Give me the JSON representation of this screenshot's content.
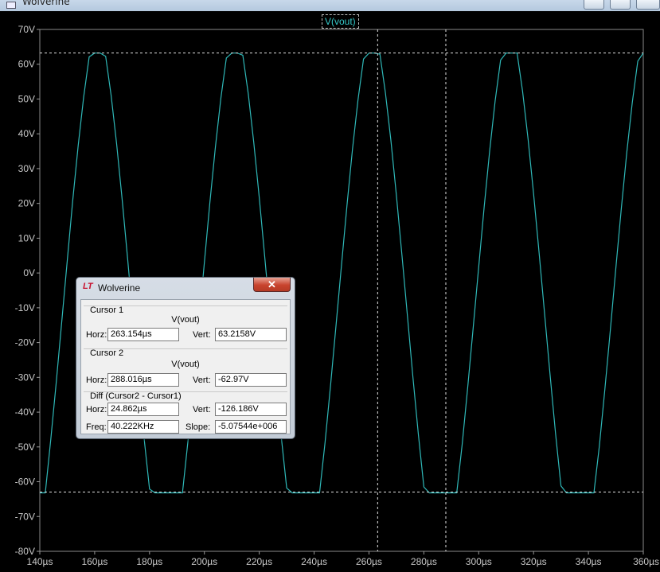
{
  "window": {
    "title": "Wolverine"
  },
  "trace_label": "V(vout)",
  "chart_data": {
    "type": "line",
    "title": "",
    "xlabel": "",
    "ylabel": "",
    "xlim": [
      140,
      360
    ],
    "ylim": [
      -80,
      70
    ],
    "x_unit": "µs",
    "y_unit": "V",
    "x_ticks": [
      140,
      160,
      180,
      200,
      220,
      240,
      260,
      280,
      300,
      320,
      340,
      360
    ],
    "y_ticks": [
      70,
      60,
      50,
      40,
      30,
      20,
      10,
      0,
      -10,
      -20,
      -30,
      -40,
      -50,
      -60,
      -70,
      -80
    ],
    "x_tick_labels": [
      "140µs",
      "160µs",
      "180µs",
      "200µs",
      "220µs",
      "240µs",
      "260µs",
      "280µs",
      "300µs",
      "320µs",
      "340µs",
      "360µs"
    ],
    "y_tick_labels": [
      "70V",
      "60V",
      "50V",
      "40V",
      "30V",
      "20V",
      "10V",
      "0V",
      "-10V",
      "-20V",
      "-30V",
      "-40V",
      "-50V",
      "-60V",
      "-70V",
      "-80V"
    ],
    "grid": false,
    "series": [
      {
        "name": "V(vout)",
        "color": "#2fb8b8",
        "x": [
          140.0,
          142.0,
          144.0,
          146.0,
          148.0,
          150.0,
          152.0,
          154.0,
          156.0,
          158.0,
          160.0,
          162.0,
          164.0,
          166.0,
          168.0,
          170.0,
          172.0,
          174.0,
          176.0,
          178.0,
          180.0,
          182.0,
          184.0,
          186.0,
          188.0,
          190.0,
          192.0,
          194.0,
          196.0,
          198.0,
          200.0,
          202.0,
          204.0,
          206.0,
          208.0,
          210.0,
          212.0,
          214.0,
          216.0,
          218.0,
          220.0,
          222.0,
          224.0,
          226.0,
          228.0,
          230.0,
          232.0,
          234.0,
          236.0,
          238.0,
          240.0,
          242.0,
          244.0,
          246.0,
          248.0,
          250.0,
          252.0,
          254.0,
          256.0,
          258.0,
          260.0,
          262.0,
          264.0,
          266.0,
          268.0,
          270.0,
          272.0,
          274.0,
          276.0,
          278.0,
          280.0,
          282.0,
          284.0,
          286.0,
          288.0,
          290.0,
          292.0,
          294.0,
          296.0,
          298.0,
          300.0,
          302.0,
          304.0,
          306.0,
          308.0,
          310.0,
          312.0,
          314.0,
          316.0,
          318.0,
          320.0,
          322.0,
          324.0,
          326.0,
          328.0,
          330.0,
          332.0,
          334.0,
          336.0,
          338.0,
          340.0,
          342.0,
          344.0,
          346.0,
          348.0,
          350.0,
          352.0,
          354.0,
          356.0,
          358.0,
          360.0
        ],
        "y": [
          -63.2,
          -63.2,
          -47.8,
          -31.3,
          -13.9,
          3.6,
          20.7,
          36.6,
          50.6,
          62.1,
          63.2,
          63.2,
          62.3,
          51.0,
          37.1,
          21.2,
          4.1,
          -13.4,
          -30.8,
          -47.3,
          -62.1,
          -63.2,
          -63.2,
          -63.2,
          -63.2,
          -63.2,
          -63.2,
          -48.3,
          -31.8,
          -14.5,
          3.0,
          20.2,
          36.1,
          50.2,
          61.8,
          63.2,
          63.2,
          62.6,
          51.4,
          37.6,
          21.8,
          4.7,
          -12.8,
          -30.3,
          -46.9,
          -61.8,
          -63.2,
          -63.2,
          -63.2,
          -63.2,
          -63.2,
          -63.2,
          -48.7,
          -32.3,
          -15.0,
          2.4,
          19.6,
          35.7,
          49.8,
          61.5,
          63.2,
          63.2,
          62.9,
          51.8,
          38.1,
          22.3,
          5.3,
          -12.2,
          -29.8,
          -46.4,
          -61.5,
          -63.2,
          -63.2,
          -63.2,
          -63.2,
          -63.2,
          -63.2,
          -49.1,
          -32.8,
          -15.6,
          1.8,
          19.1,
          35.2,
          49.4,
          61.2,
          63.2,
          63.2,
          63.2,
          52.2,
          38.5,
          22.8,
          5.9,
          -11.6,
          -29.2,
          -45.9,
          -61.2,
          -63.2,
          -63.2,
          -63.2,
          -63.2,
          -63.2,
          -63.2,
          -49.6,
          -33.3,
          -16.2,
          1.3,
          18.5,
          34.7,
          49.0,
          60.9,
          63.2
        ]
      }
    ],
    "cursors": {
      "horizontal": [
        63.2158,
        -62.97
      ],
      "vertical": [
        263.154,
        288.016
      ]
    }
  },
  "dialog": {
    "title": "Wolverine",
    "logo": "LT",
    "close_glyph": "✕",
    "cursor1": {
      "heading": "Cursor 1",
      "trace": "V(vout)",
      "horz_label": "Horz:",
      "horz_value": "263.154µs",
      "vert_label": "Vert:",
      "vert_value": "63.2158V"
    },
    "cursor2": {
      "heading": "Cursor 2",
      "trace": "V(vout)",
      "horz_label": "Horz:",
      "horz_value": "288.016µs",
      "vert_label": "Vert:",
      "vert_value": "-62.97V"
    },
    "diff": {
      "heading": "Diff (Cursor2 - Cursor1)",
      "horz_label": "Horz:",
      "horz_value": "24.862µs",
      "vert_label": "Vert:",
      "vert_value": "-126.186V",
      "freq_label": "Freq:",
      "freq_value": "40.222KHz",
      "slope_label": "Slope:",
      "slope_value": "-5.07544e+006"
    }
  }
}
